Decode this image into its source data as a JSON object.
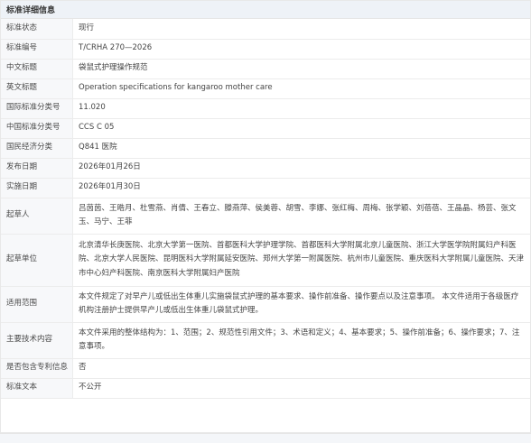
{
  "section": {
    "title": "标准详细信息"
  },
  "rows": [
    {
      "label": "标准状态",
      "value": "现行"
    },
    {
      "label": "标准编号",
      "value": "T/CRHA 270—2026"
    },
    {
      "label": "中文标题",
      "value": "袋鼠式护理操作规范"
    },
    {
      "label": "英文标题",
      "value": "Operation specifications for kangaroo mother care"
    },
    {
      "label": "国际标准分类号",
      "value": "11.020"
    },
    {
      "label": "中国标准分类号",
      "value": "CCS C 05"
    },
    {
      "label": "国民经济分类",
      "value": "Q841 医院"
    },
    {
      "label": "发布日期",
      "value": "2026年01月26日"
    },
    {
      "label": "实施日期",
      "value": "2026年01月30日"
    },
    {
      "label": "起草人",
      "value": "吕茵茵、王晧月、杜雪燕、肖倩、王春立、滕燕萍、侯美蓉、胡雪、李娜、张红梅、周梅、张学颖、刘蓓蓓、王晶晶、杨芸、张文玉、马宁、王菲"
    },
    {
      "label": "起草单位",
      "value": "北京清华长庚医院、北京大学第一医院、首都医科大学护理学院、首都医科大学附属北京儿童医院、浙江大学医学院附属妇产科医院、北京大学人民医院、昆明医科大学附属延安医院、郑州大学第一附属医院、杭州市儿童医院、重庆医科大学附属儿童医院、天津市中心妇产科医院、南京医科大学附属妇产医院"
    },
    {
      "label": "适用范围",
      "value": "本文件规定了对早产儿或低出生体重儿实施袋鼠式护理的基本要求、操作前准备、操作要点以及注意事项。 本文件适用于各级医疗机构注册护士提供早产儿或低出生体重儿袋鼠式护理。"
    },
    {
      "label": "主要技术内容",
      "value": "本文件采用的整体结构为：1、范围；2、规范性引用文件；3、术语和定义；4、基本要求；5、操作前准备；6、操作要求；7、注意事项。"
    },
    {
      "label": "是否包含专利信息",
      "value": "否"
    },
    {
      "label": "标准文本",
      "value": "不公开"
    }
  ]
}
